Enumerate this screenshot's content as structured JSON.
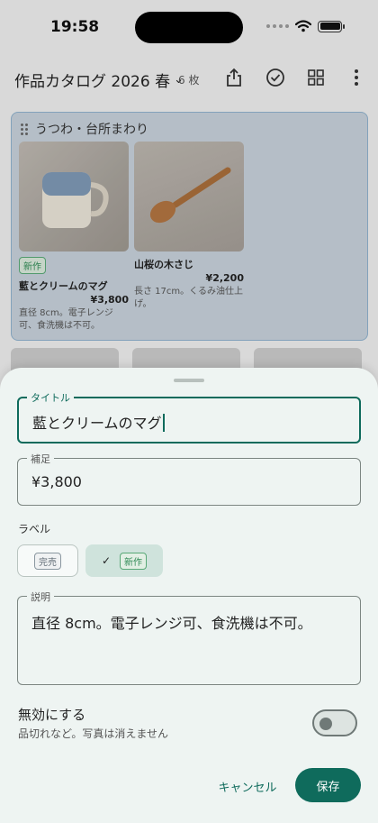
{
  "status_bar": {
    "time": "19:58"
  },
  "app_bar": {
    "title": "作品カタログ 2026 春",
    "count": "6 枚"
  },
  "group": {
    "name": "うつわ・台所まわり",
    "cards": [
      {
        "tag": "新作",
        "title": "藍とクリームのマグ",
        "price": "¥3,800",
        "desc": "直径 8cm。電子レンジ可、食洗機は不可。"
      },
      {
        "tag": "",
        "title": "山桜の木さじ",
        "price": "¥2,200",
        "desc": "長さ 17cm。くるみ油仕上げ。"
      }
    ]
  },
  "sheet": {
    "title_field": {
      "label": "タイトル",
      "value": "藍とクリームのマグ"
    },
    "note_field": {
      "label": "補足",
      "value": "¥3,800"
    },
    "label_section": "ラベル",
    "chips": [
      {
        "label": "完売",
        "selected": false
      },
      {
        "label": "新作",
        "selected": true
      }
    ],
    "check_mark": "✓",
    "description_field": {
      "label": "説明",
      "value": "直径 8cm。電子レンジ可、食洗機は不可。"
    },
    "disable_toggle": {
      "title": "無効にする",
      "subtitle": "品切れなど。写真は消えません",
      "on": false
    },
    "cancel_label": "キャンセル",
    "save_label": "保存"
  },
  "colors": {
    "accent": "#0f6b5c",
    "sheet_bg": "#eef4f2",
    "new_tag": "#2f8a55"
  }
}
